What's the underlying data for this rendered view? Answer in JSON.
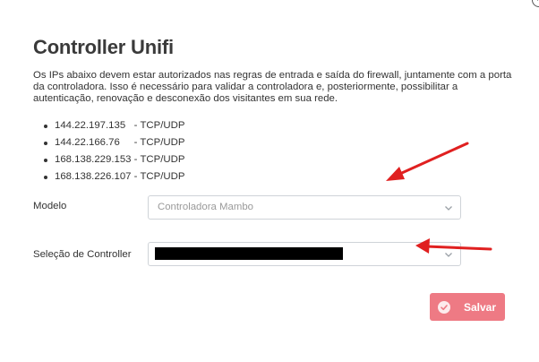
{
  "dialog": {
    "title": "Controller Unifi",
    "description": "Os IPs abaixo devem estar autorizados nas regras de entrada e saída do firewall, juntamente com a porta da controladora. Isso é necessário para validar a controladora e, posteriormente, possibilitar a autenticação, renovação e desconexão dos visitantes em sua rede.",
    "ips": [
      {
        "address": "144.22.197.135",
        "sep": "   - ",
        "protocol": "TCP/UDP"
      },
      {
        "address": "144.22.166.76",
        "sep": "     - ",
        "protocol": "TCP/UDP"
      },
      {
        "address": "168.138.229.153",
        "sep": " - ",
        "protocol": "TCP/UDP"
      },
      {
        "address": "168.138.226.107",
        "sep": " - ",
        "protocol": "TCP/UDP"
      }
    ]
  },
  "form": {
    "modelo": {
      "label": "Modelo",
      "value": "Controladora Mambo"
    },
    "controller": {
      "label": "Seleção de Controller",
      "value": ""
    }
  },
  "actions": {
    "save_label": "Salvar"
  },
  "colors": {
    "save_button": "#ee7a84",
    "annotation_arrow": "#e02020"
  },
  "icons": {
    "close": "close-icon",
    "select_chevron": "chevron-down-icon",
    "save": "check-circle-icon"
  }
}
